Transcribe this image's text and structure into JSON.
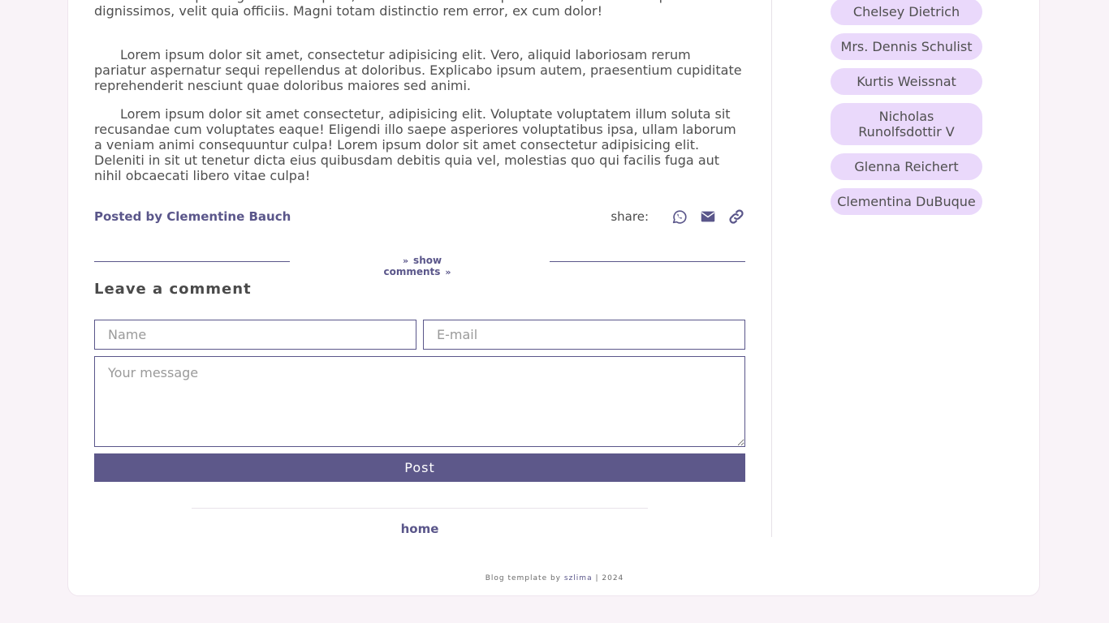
{
  "article": {
    "paragraph_1": "consectetur adipisicing elit. Ut tempora, necessitatibus a in explicabo nam, amet suscipit odio dignissimos, velit quia officiis. Magni totam distinctio rem error, ex cum dolor!",
    "paragraph_2": "Lorem ipsum dolor sit amet, consectetur adipisicing elit. Vero, aliquid laboriosam rerum pariatur aspernatur sequi repellendus at doloribus. Explicabo ipsum autem, praesentium cupiditate reprehenderit nesciunt quae doloribus maiores sed animi.",
    "paragraph_3": "Lorem ipsum dolor sit amet consectetur, adipisicing elit. Voluptate voluptatem illum soluta sit recusandae cum voluptates eaque! Eligendi illo saepe asperiores voluptatibus ipsa, ullam laborum a veniam animi consequuntur culpa! Lorem ipsum dolor sit amet consectetur adipisicing elit. Deleniti in sit ut tenetur dicta eius quibusdam debitis quia vel, molestias quo qui facilis fuga aut nihil obcaecati libero vitae culpa!",
    "posted_by": "Posted by Clementine Bauch"
  },
  "share": {
    "label": "share:",
    "icons": [
      "whatsapp-icon",
      "mail-icon",
      "link-icon"
    ]
  },
  "comments": {
    "toggle_label": "show comments",
    "title": "Leave a comment",
    "name_placeholder": "Name",
    "email_placeholder": "E-mail",
    "message_placeholder": "Your message",
    "post_label": "Post"
  },
  "nav": {
    "home_label": "home"
  },
  "sidebar": {
    "authors": [
      "Chelsey Dietrich",
      "Mrs. Dennis Schulist",
      "Kurtis Weissnat",
      "Nicholas Runolfsdottir V",
      "Glenna Reichert",
      "Clementina DuBuque"
    ]
  },
  "footer": {
    "prefix": "Blog template by",
    "author": "szlima",
    "suffix": "| 2024"
  },
  "colors": {
    "accent": "#5d588a",
    "chip": "#ead9fb",
    "background": "#f9f3f8"
  }
}
